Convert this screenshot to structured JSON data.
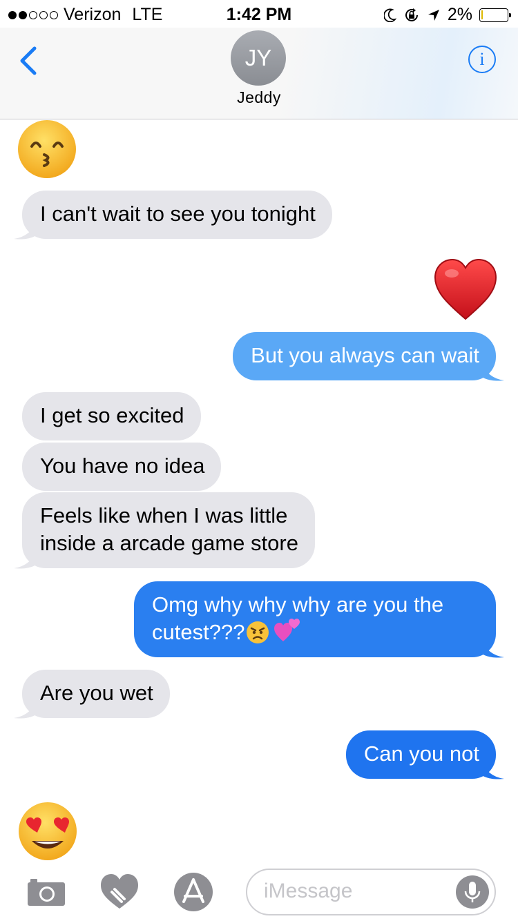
{
  "status_bar": {
    "carrier": "Verizon",
    "network": "LTE",
    "time": "1:42 PM",
    "battery_percent": "2%",
    "signal_bars_filled": 2,
    "signal_bars_total": 5
  },
  "nav": {
    "avatar_initials": "JY",
    "contact_name": "Jeddy",
    "info_glyph": "i",
    "back_icon": "chevron-left-icon"
  },
  "messages": [
    {
      "dir": "in",
      "kind": "emoji",
      "emoji": "kissing-smiling-eyes-emoji"
    },
    {
      "dir": "in",
      "text": "I can't wait to see you tonight"
    },
    {
      "dir": "out",
      "kind": "emoji",
      "emoji": "red-heart-emoji"
    },
    {
      "dir": "out",
      "text": "But you always can wait"
    },
    {
      "dir": "in",
      "text": "I get so excited"
    },
    {
      "dir": "in",
      "text": "You have no idea"
    },
    {
      "dir": "in",
      "text_line1": "Feels like when I was little",
      "text_line2": "inside a arcade game store"
    },
    {
      "dir": "out",
      "text_line1": "Omg why why why are you the",
      "text_line2": "cutest???",
      "trailing_emojis": [
        "angry-face-emoji",
        "two-hearts-emoji"
      ]
    },
    {
      "dir": "in",
      "text": "Are you wet"
    },
    {
      "dir": "out",
      "text": "Can you not"
    },
    {
      "dir": "in",
      "kind": "emoji",
      "emoji": "heart-eyes-emoji"
    }
  ],
  "toolbar": {
    "input_placeholder": "iMessage",
    "icons": [
      "camera-icon",
      "digital-touch-icon",
      "app-store-icon",
      "microphone-icon"
    ]
  },
  "colors": {
    "incoming_bubble": "#e5e5ea",
    "outgoing_bubble": "#2f8cf6",
    "accent": "#1a7cf5"
  }
}
